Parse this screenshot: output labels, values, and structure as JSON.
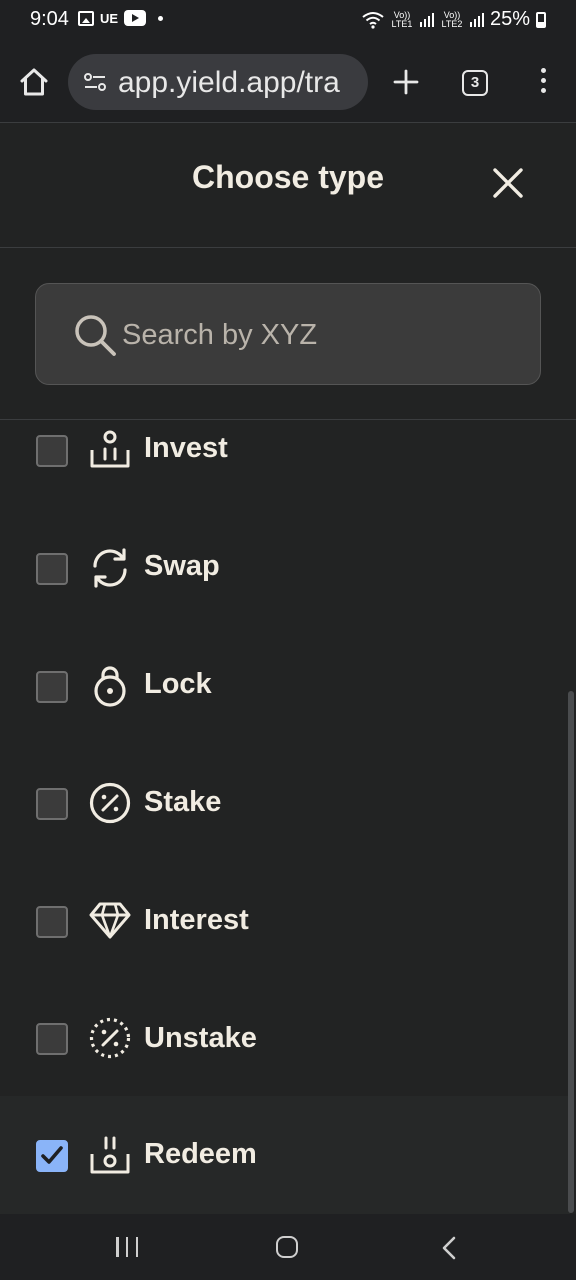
{
  "status_bar": {
    "time": "9:04",
    "carrier_tag": "UE",
    "sim1_label": "Vo)) LTE1",
    "sim2_label": "Vo)) LTE2",
    "battery_text": "25%"
  },
  "browser": {
    "url_text": "app.yield.app/tra",
    "tab_count": "3"
  },
  "modal": {
    "title": "Choose type",
    "search_placeholder": "Search by XYZ",
    "items": [
      {
        "label": "Invest",
        "icon": "invest-icon",
        "checked": false
      },
      {
        "label": "Swap",
        "icon": "swap-icon",
        "checked": false
      },
      {
        "label": "Lock",
        "icon": "lock-icon",
        "checked": false
      },
      {
        "label": "Stake",
        "icon": "stake-percent-icon",
        "checked": false
      },
      {
        "label": "Interest",
        "icon": "diamond-icon",
        "checked": false
      },
      {
        "label": "Unstake",
        "icon": "unstake-percent-icon",
        "checked": false
      },
      {
        "label": "Redeem",
        "icon": "redeem-icon",
        "checked": true
      }
    ]
  },
  "colors": {
    "background": "#222323",
    "text": "#f1ece2",
    "checkbox_checked": "#8ab4f8"
  }
}
